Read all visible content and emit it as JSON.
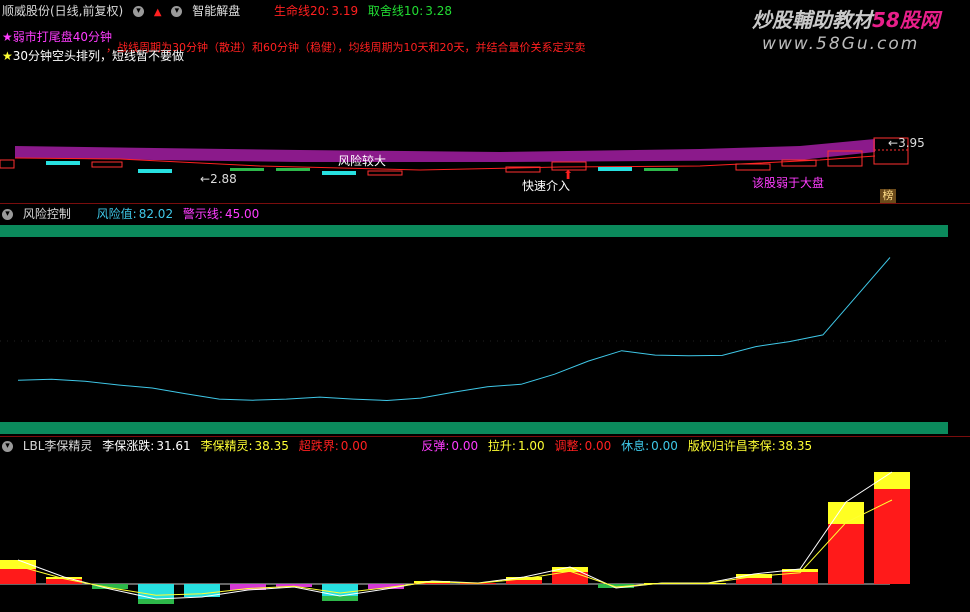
{
  "colors": {
    "bg": "#000000",
    "sep": "#7a0d0d",
    "green_band": "#0b8a5c",
    "cyan": "#3fc8e8",
    "magenta": "#ff3cff",
    "red": "#ff2020",
    "yellow": "#ffff33",
    "purple": "#8b1a8b"
  },
  "top": {
    "stock_title": "顺威股份(日线,前复权)",
    "indicator_name": "智能解盘",
    "lifeline_label": "生命线20:",
    "lifeline_value": "3.19",
    "money_line_label": "取舍线10:",
    "money_line_value": "3.28",
    "watermark_cn": "炒股輔助教材",
    "watermark_brand": "58股网",
    "watermark_url": "www.58Gu.com",
    "notice_line1": "弱市打尾盘40分钟",
    "notice_line1_right": "，战线周期为30分钟（散进）和60分钟（稳健），均线周期为10天和20天，并结合量价关系定买卖",
    "notice_line2": "30分钟空头排列，短线暂不要做",
    "risk_big": "风险较大",
    "quick_intervene": "快速介入",
    "weaker_than_market": "该股弱于大盘",
    "low_price": "2.88",
    "high_price": "3.95",
    "corner_badge": "榜"
  },
  "mid": {
    "name": "风险控制",
    "risk_label": "风险值:",
    "risk_value": "82.02",
    "alert_label": "警示线:",
    "alert_value": "45.00",
    "risk_series": [
      41.5,
      41.8,
      41.2,
      40.1,
      39.2,
      37.5,
      35.9,
      35.6,
      35.9,
      36.5,
      35.9,
      35.5,
      36.2,
      38.0,
      39.6,
      40.3,
      43.3,
      47.2,
      50.3,
      49.0,
      48.8,
      48.9,
      51.5,
      53.0,
      55.0,
      66.5,
      78.0
    ]
  },
  "bot": {
    "name": "LBL李保精灵",
    "items": [
      {
        "label": "李保涨跌:",
        "value": "31.61"
      },
      {
        "label": "李保精灵:",
        "value": "38.35"
      },
      {
        "label": "超跌界:",
        "value": "0.00"
      },
      {
        "label": "反弹:",
        "value": "0.00"
      },
      {
        "label": "拉升:",
        "value": "1.00"
      },
      {
        "label": "调整:",
        "value": "0.00"
      },
      {
        "label": "休息:",
        "value": "0.00"
      },
      {
        "label": "版权归许昌李保:",
        "value": "38.35"
      }
    ],
    "bars": [
      {
        "kind": "pos",
        "red": 15,
        "yellow": 9
      },
      {
        "kind": "pos",
        "red": 5,
        "yellow": 2
      },
      {
        "kind": "neg",
        "color": "#2db84a",
        "h": 5
      },
      {
        "kind": "neg",
        "color": "#27e0e0",
        "h": 15,
        "extra": "#2db84a",
        "eh": 5
      },
      {
        "kind": "neg",
        "color": "#27e0e0",
        "h": 13
      },
      {
        "kind": "neg",
        "color": "#d43ad4",
        "h": 6
      },
      {
        "kind": "neg",
        "color": "#d43ad4",
        "h": 3
      },
      {
        "kind": "neg",
        "color": "#27e0e0",
        "h": 12,
        "extra": "#2db84a",
        "eh": 5
      },
      {
        "kind": "neg",
        "color": "#d43ad4",
        "h": 5
      },
      {
        "kind": "pos",
        "red": 1,
        "yellow": 2
      },
      {
        "kind": "pos",
        "red": 1,
        "yellow": 0
      },
      {
        "kind": "pos",
        "red": 4,
        "yellow": 3
      },
      {
        "kind": "pos",
        "red": 12,
        "yellow": 5
      },
      {
        "kind": "neg",
        "color": "#2db84a",
        "h": 4
      },
      {
        "kind": "pos",
        "red": 0,
        "yellow": 1
      },
      {
        "kind": "pos",
        "red": 0,
        "yellow": 1
      },
      {
        "kind": "pos",
        "red": 6,
        "yellow": 4
      },
      {
        "kind": "pos",
        "red": 12,
        "yellow": 3
      },
      {
        "kind": "pos",
        "red": 60,
        "yellow": 22
      },
      {
        "kind": "pos",
        "red": 95,
        "yellow": 17
      }
    ]
  }
}
